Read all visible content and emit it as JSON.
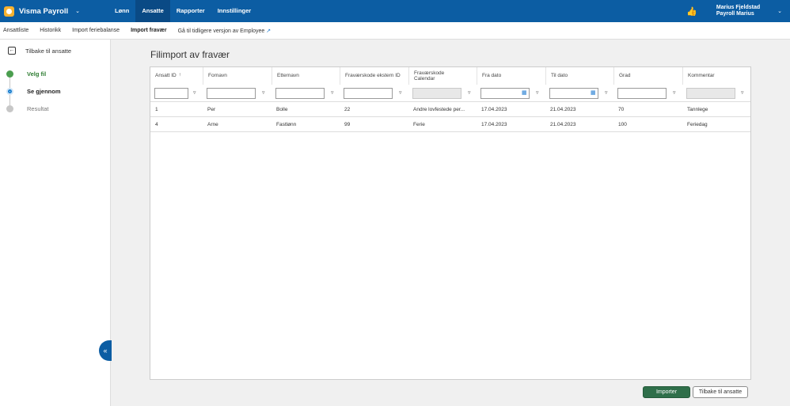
{
  "app": {
    "title": "Visma Payroll",
    "chevron": "⌄"
  },
  "mainnav": {
    "items": [
      {
        "label": "Lønn"
      },
      {
        "label": "Ansatte"
      },
      {
        "label": "Rapporter"
      },
      {
        "label": "Innstillinger"
      }
    ]
  },
  "user": {
    "name": "Marius Fjeldstad",
    "company": "Payroll Marius"
  },
  "subnav": {
    "items": [
      {
        "label": "Ansattliste"
      },
      {
        "label": "Historikk"
      },
      {
        "label": "Import feriebalanse"
      },
      {
        "label": "Import fravær"
      },
      {
        "label": "Gå til tidligere versjon av Employee"
      }
    ]
  },
  "sidebar": {
    "back_label": "Tilbake til ansatte",
    "steps": [
      {
        "label": "Velg fil",
        "state": "done"
      },
      {
        "label": "Se gjennom",
        "state": "current"
      },
      {
        "label": "Resultat",
        "state": "todo"
      }
    ]
  },
  "page": {
    "title": "Filimport av fravær"
  },
  "grid": {
    "columns": [
      {
        "label": "Ansatt ID",
        "sorted": "asc"
      },
      {
        "label": "Fornavn"
      },
      {
        "label": "Etternavn"
      },
      {
        "label": "Fraværskode ekstern ID"
      },
      {
        "label": "Fraværskode Calendar"
      },
      {
        "label": "Fra dato"
      },
      {
        "label": "Til dato"
      },
      {
        "label": "Grad"
      },
      {
        "label": "Kommentar"
      }
    ],
    "sort_icon": "↑",
    "rows": [
      [
        "1",
        "Per",
        "Bolle",
        "22",
        "Andre lovfestede per...",
        "17.04.2023",
        "21.04.2023",
        "70",
        "Tannlege"
      ],
      [
        "4",
        "Arne",
        "Fastlønn",
        "99",
        "Ferie",
        "17.04.2023",
        "21.04.2023",
        "100",
        "Feriedag"
      ]
    ]
  },
  "actions": {
    "import_label": "Importer",
    "back_label": "Tilbake til ansatte"
  },
  "colors": {
    "topbar": "#0c5da3",
    "nav_active": "#0a4a85",
    "primary_button": "#2f6f4a",
    "step_done": "#4b9e4f",
    "step_current": "#1c80cf"
  },
  "icons": {
    "external": "↗",
    "filter": "▿",
    "calendar": "▦",
    "collapse": "«",
    "back": "←",
    "user": "👍"
  }
}
